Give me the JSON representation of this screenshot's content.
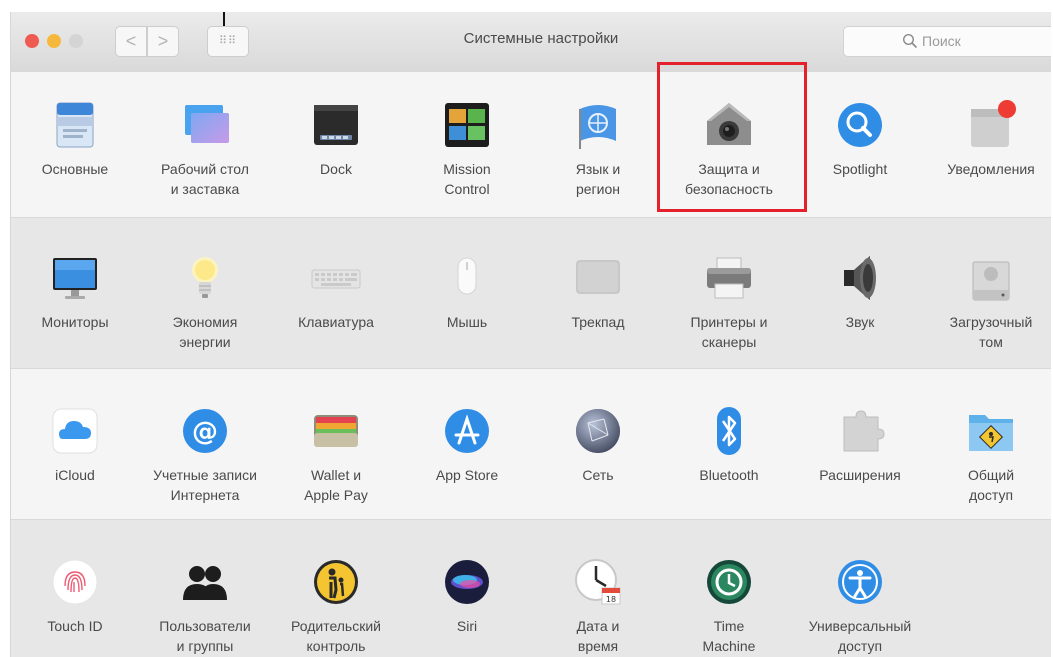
{
  "window": {
    "title": "Системные настройки",
    "search_placeholder": "Поиск",
    "back_glyph": "<",
    "forward_glyph": ">",
    "grid_glyph": "⠿⠿"
  },
  "colors": {
    "close": "#ef5a51",
    "minimize": "#f6b83c",
    "maximize": "#d4d4d4",
    "highlight": "#e3202b"
  },
  "rows": [
    [
      {
        "label": "Основные",
        "icon": "general-icon"
      },
      {
        "label": "Рабочий стол\nи заставка",
        "icon": "desktop-screensaver-icon"
      },
      {
        "label": "Dock",
        "icon": "dock-icon"
      },
      {
        "label": "Mission\nControl",
        "icon": "mission-control-icon"
      },
      {
        "label": "Язык и\nрегион",
        "icon": "language-region-icon"
      },
      {
        "label": "Защита и\nбезопасность",
        "icon": "security-icon"
      },
      {
        "label": "Spotlight",
        "icon": "spotlight-icon"
      },
      {
        "label": "Уведомления",
        "icon": "notifications-icon"
      }
    ],
    [
      {
        "label": "Мониторы",
        "icon": "displays-icon"
      },
      {
        "label": "Экономия\nэнергии",
        "icon": "energy-saver-icon"
      },
      {
        "label": "Клавиатура",
        "icon": "keyboard-icon"
      },
      {
        "label": "Мышь",
        "icon": "mouse-icon"
      },
      {
        "label": "Трекпад",
        "icon": "trackpad-icon"
      },
      {
        "label": "Принтеры и\nсканеры",
        "icon": "printers-scanners-icon"
      },
      {
        "label": "Звук",
        "icon": "sound-icon"
      },
      {
        "label": "Загрузочный\nтом",
        "icon": "startup-disk-icon"
      }
    ],
    [
      {
        "label": "iCloud",
        "icon": "icloud-icon"
      },
      {
        "label": "Учетные записи\nИнтернета",
        "icon": "internet-accounts-icon"
      },
      {
        "label": "Wallet и\nApple Pay",
        "icon": "wallet-icon"
      },
      {
        "label": "App Store",
        "icon": "app-store-icon"
      },
      {
        "label": "Сеть",
        "icon": "network-icon"
      },
      {
        "label": "Bluetooth",
        "icon": "bluetooth-icon"
      },
      {
        "label": "Расширения",
        "icon": "extensions-icon"
      },
      {
        "label": "Общий\nдоступ",
        "icon": "sharing-icon"
      }
    ],
    [
      {
        "label": "Touch ID",
        "icon": "touch-id-icon"
      },
      {
        "label": "Пользователи\nи группы",
        "icon": "users-groups-icon"
      },
      {
        "label": "Родительский\nконтроль",
        "icon": "parental-controls-icon"
      },
      {
        "label": "Siri",
        "icon": "siri-icon"
      },
      {
        "label": "Дата и\nвремя",
        "icon": "date-time-icon"
      },
      {
        "label": "Time\nMachine",
        "icon": "time-machine-icon"
      },
      {
        "label": "Универсальный\nдоступ",
        "icon": "accessibility-icon"
      }
    ]
  ]
}
